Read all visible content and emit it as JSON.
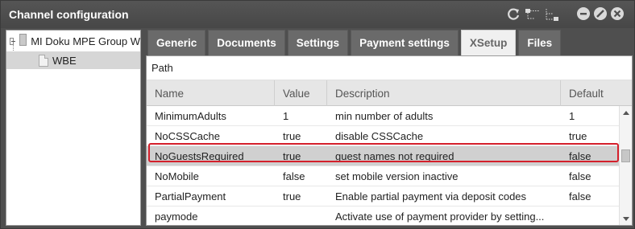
{
  "window": {
    "title": "Channel configuration"
  },
  "toolbar_icons": [
    "refresh-icon",
    "collapse-tree-icon",
    "expand-tree-icon"
  ],
  "window_buttons": [
    "minimize-icon",
    "maximize-icon",
    "close-icon"
  ],
  "tree": {
    "root_label": "MI Doku MPE Group W",
    "child_label": "WBE"
  },
  "tabs": [
    {
      "label": "Generic"
    },
    {
      "label": "Documents"
    },
    {
      "label": "Settings"
    },
    {
      "label": "Payment settings"
    },
    {
      "label": "XSetup",
      "active": true
    },
    {
      "label": "Files"
    }
  ],
  "path_label": "Path",
  "table": {
    "headers": {
      "name": "Name",
      "value": "Value",
      "description": "Description",
      "default": "Default"
    },
    "rows": [
      {
        "name": "MinimumAdults",
        "value": "1",
        "description": "min number of adults",
        "default": "1"
      },
      {
        "name": "NoCSSCache",
        "value": "true",
        "description": "disable CSSCache",
        "default": "true"
      },
      {
        "name": "NoGuestsRequired",
        "value": "true",
        "description": "guest names not required",
        "default": "false"
      },
      {
        "name": "NoMobile",
        "value": "false",
        "description": "set mobile version inactive",
        "default": "false"
      },
      {
        "name": "PartialPayment",
        "value": "true",
        "description": "Enable partial payment via deposit codes",
        "default": "false"
      },
      {
        "name": "paymode",
        "value": "",
        "description": "Activate use of payment provider by setting...",
        "default": ""
      }
    ]
  },
  "colors": {
    "highlight": "#d4202c",
    "titlebar": "#4f4f4f",
    "selected_row": "#d0d0d0"
  }
}
